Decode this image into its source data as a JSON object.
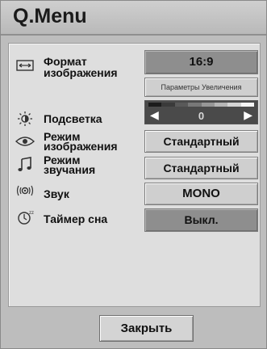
{
  "menu": {
    "title": "Q.Menu",
    "close_label": "Закрыть"
  },
  "items": {
    "aspect": {
      "label_line1": "Формат",
      "label_line2": "изображения",
      "value": "16:9",
      "sub_value": "Параметры Увеличения",
      "icon": "aspect-ratio-icon"
    },
    "backlight": {
      "label": "Подсветка",
      "value": "0",
      "icon": "brightness-icon"
    },
    "picture_mode": {
      "label_line1": "Режим",
      "label_line2": "изображения",
      "value": "Стандартный",
      "icon": "eye-icon"
    },
    "sound_mode": {
      "label_line1": "Режим",
      "label_line2": "звучания",
      "value": "Стандартный",
      "icon": "music-note-icon"
    },
    "audio": {
      "label": "Звук",
      "value": "MONO",
      "icon": "speaker-icon"
    },
    "sleep_timer": {
      "label": "Таймер сна",
      "value": "Выкл.",
      "icon": "sleep-timer-icon"
    }
  },
  "colors": {
    "background": "#bdbdbd",
    "panel": "#dedede",
    "selected": "#8e8e8e",
    "slider": "#4a4a4a"
  }
}
